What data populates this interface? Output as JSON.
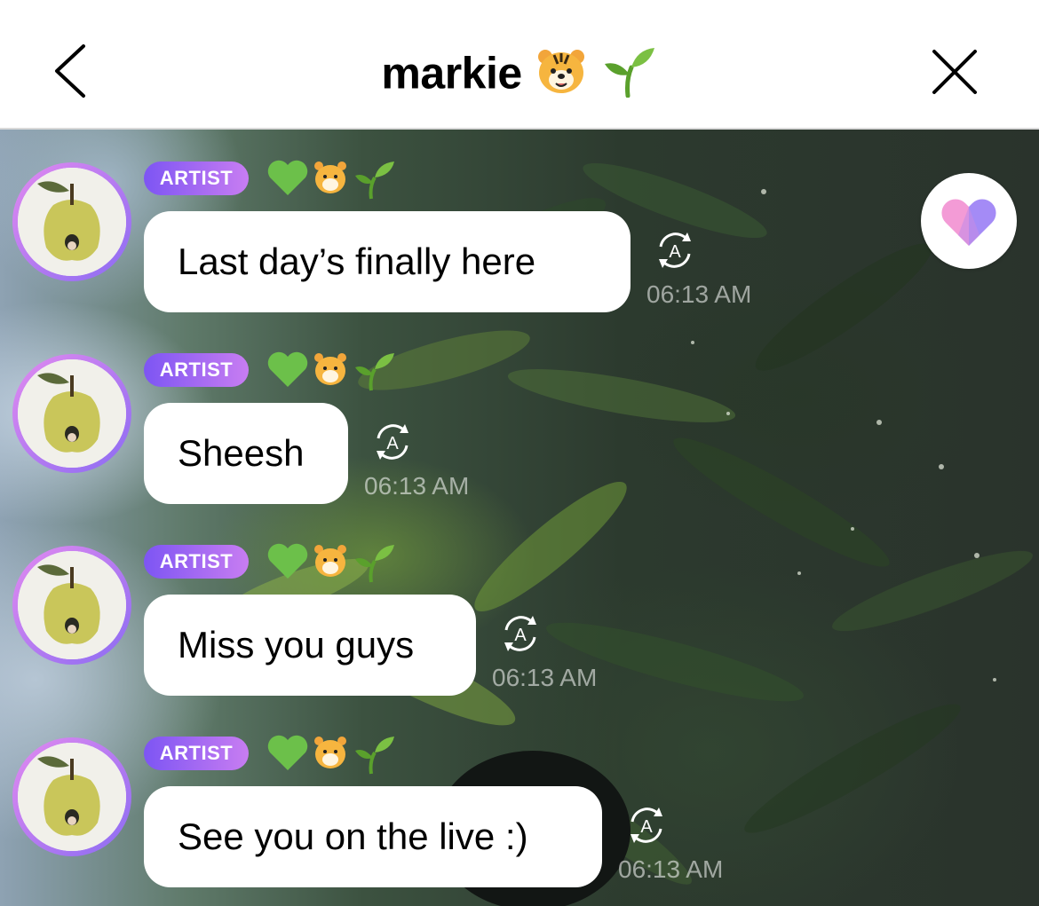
{
  "header": {
    "title": "markie",
    "title_emojis": [
      "tiger-face-emoji",
      "seedling-emoji"
    ],
    "back_icon": "chevron-left-icon",
    "close_icon": "close-icon"
  },
  "reaction_button": {
    "icon": "heart-icon",
    "colors": [
      "#f39bd6",
      "#9a7ef5"
    ]
  },
  "messages": [
    {
      "badge": "ARTIST",
      "text": "Last day’s finally here",
      "time": "06:13 AM"
    },
    {
      "badge": "ARTIST",
      "text": "Sheesh",
      "time": "06:13 AM"
    },
    {
      "badge": "ARTIST",
      "text": "Miss you guys",
      "time": "06:13 AM"
    },
    {
      "badge": "ARTIST",
      "text": "See you on the live :)",
      "time": "06:13 AM"
    }
  ],
  "name_emojis": [
    "green-heart-emoji",
    "tiger-face-emoji",
    "seedling-emoji"
  ],
  "colors": {
    "badge_start": "#7d55f3",
    "badge_end": "#c87df2",
    "avatar_ring": "#a979f3"
  }
}
